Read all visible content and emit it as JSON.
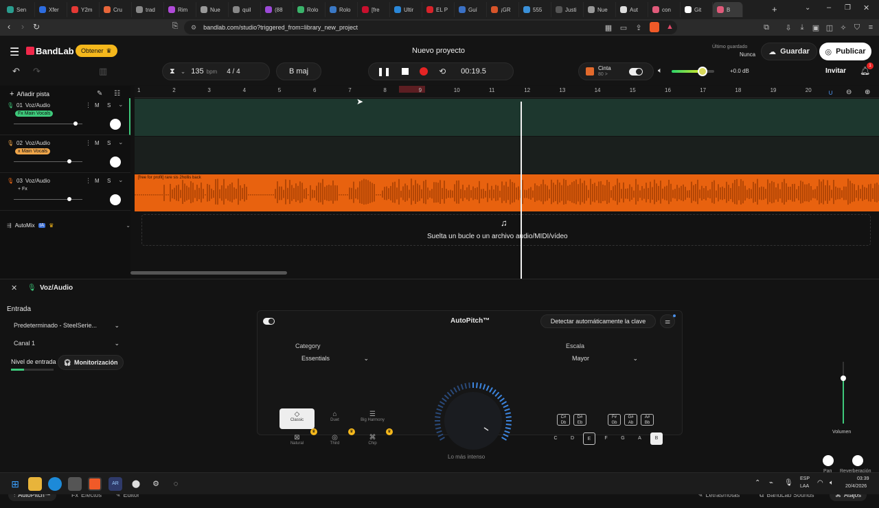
{
  "browser": {
    "tabs": [
      "Sen",
      "Xfer",
      "Y2m",
      "Cru",
      "trad",
      "Rim",
      "Nue",
      "quil",
      "(88",
      "Rolo",
      "Rolo",
      "[fre",
      "Ultir",
      "EL P",
      "Guí",
      "¡GR",
      "555",
      "Justi",
      "Nue",
      "Aut",
      "con",
      "Git",
      "B"
    ],
    "url": "bandlab.com/studio?triggered_from=library_new_project"
  },
  "header": {
    "brand": "BandLab",
    "get_label": "Obtener",
    "project_title": "Nuevo proyecto",
    "saved_label": "Último guardado",
    "saved_value": "Nunca",
    "save_label": "Guardar",
    "publish_label": "Publicar",
    "invite_label": "Invitar",
    "notif_count": "1"
  },
  "transport": {
    "bpm": "135",
    "bpm_unit": "bpm",
    "time_sig": "4 / 4",
    "key": "B maj",
    "time": "00:19.5",
    "tape_label": "Cinta",
    "tape_sub": "80 >",
    "volume_db": "+0.0 dB"
  },
  "tracks": [
    {
      "num": "01",
      "name": "Voz/Audio",
      "badge": "Fx Main Vocals",
      "badge_color": "#3ec97b",
      "volume_level": 0.9
    },
    {
      "num": "02",
      "name": "Voz/Audio",
      "badge": "x Main Vocals",
      "badge_color": "#f0a64a",
      "volume_level": 0.81
    },
    {
      "num": "03",
      "name": "Voz/Audio",
      "badge": "+ Fx",
      "badge_color": "",
      "volume_level": 0.81
    }
  ],
  "track_controls": {
    "mute": "M",
    "solo": "S"
  },
  "add_track_label": "Añadir pista",
  "automix_label": "AutoMix",
  "automix_badge": "IA",
  "ruler": [
    "1",
    "2",
    "3",
    "4",
    "5",
    "6",
    "7",
    "8",
    "9",
    "10",
    "11",
    "12",
    "13",
    "14",
    "15",
    "16",
    "17",
    "18",
    "19",
    "20"
  ],
  "clip_title": "[free for profit] rare sis 2hollis back",
  "drop_hint": "Suelta un bucle o un archivo audio/MIDI/vídeo",
  "panel": {
    "track_name": "Voz/Audio",
    "input_label": "Entrada",
    "input_device": "Predeterminado - SteelSerie...",
    "channel": "Canal 1",
    "input_level_label": "Nivel de entrada",
    "monitor_label": "Monitorización",
    "volume_label": "Volumen",
    "pan_label": "Pan",
    "reverb_label": "Reverberación"
  },
  "autopitch": {
    "title": "AutoPitch™",
    "detect_label": "Detectar automáticamente la clave",
    "category_label": "Category",
    "category_value": "Essentials",
    "scale_label": "Escala",
    "scale_value": "Mayor",
    "knob_caption": "Lo más intenso",
    "presets": [
      "Classic",
      "Duet",
      "Big Harmony",
      "Natural",
      "Third",
      "Chip"
    ],
    "chords": [
      [
        "C#",
        "Db"
      ],
      [
        "D#",
        "Eb"
      ],
      [
        "F#",
        "Gb"
      ],
      [
        "G#",
        "Ab"
      ],
      [
        "A#",
        "Bb"
      ]
    ],
    "notes": [
      "C",
      "D",
      "E",
      "F",
      "G",
      "A",
      "B"
    ]
  },
  "footer": {
    "autopitch_tab": "AutoPitch™",
    "effects_tab": "Efectos",
    "editor_tab": "Editor",
    "lyrics_label": "Letras/notas",
    "sounds_label": "BandLab Sounds",
    "shortcuts_label": "Atajos"
  },
  "taskbar": {
    "lang": "ESP",
    "lang2": "LAA",
    "clock": "03:39",
    "date": "20/4/2026"
  },
  "colors": {
    "accent_orange": "#f26a14",
    "record_red": "#e52424",
    "green_lane": "#1c3a2e",
    "brand_red": "#f0284a"
  }
}
